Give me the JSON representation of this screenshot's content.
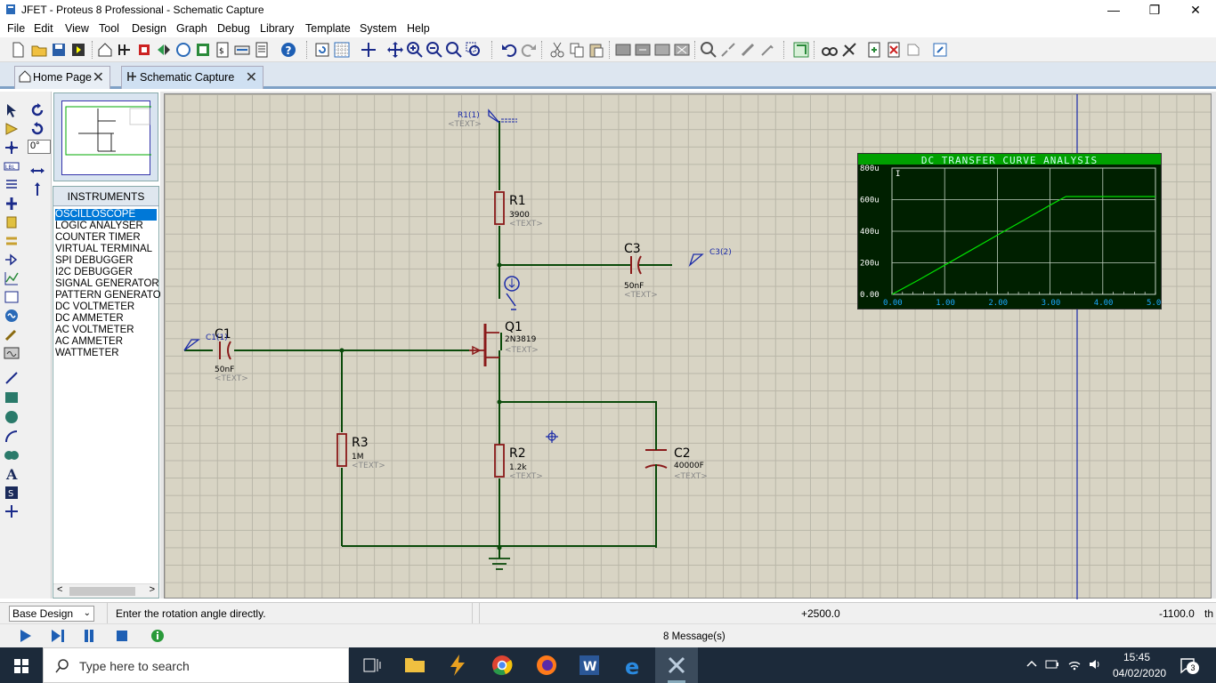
{
  "window": {
    "title": "JFET - Proteus 8 Professional - Schematic Capture",
    "minimize": "—",
    "restore": "❐",
    "close": "✕"
  },
  "menu": [
    "File",
    "Edit",
    "View",
    "Tool",
    "Design",
    "Graph",
    "Debug",
    "Library",
    "Template",
    "System",
    "Help"
  ],
  "tabs": [
    {
      "label": "Home Page",
      "close": "✕"
    },
    {
      "label": "Schematic Capture",
      "close": "✕"
    }
  ],
  "rotation": {
    "value": "0°"
  },
  "instruments": {
    "header": "INSTRUMENTS",
    "items": [
      "OSCILLOSCOPE",
      "LOGIC ANALYSER",
      "COUNTER TIMER",
      "VIRTUAL TERMINAL",
      "SPI DEBUGGER",
      "I2C DEBUGGER",
      "SIGNAL GENERATOR",
      "PATTERN GENERATO",
      "DC VOLTMETER",
      "DC AMMETER",
      "AC VOLTMETER",
      "AC AMMETER",
      "WATTMETER"
    ],
    "selected": 0
  },
  "schematic": {
    "components": {
      "R1": {
        "ref": "R1",
        "value": "3900",
        "text": "<TEXT>"
      },
      "R2": {
        "ref": "R2",
        "value": "1.2k",
        "text": "<TEXT>"
      },
      "R3": {
        "ref": "R3",
        "value": "1M",
        "text": "<TEXT>"
      },
      "C1": {
        "ref": "C1",
        "value": "50nF",
        "text": "<TEXT>"
      },
      "C2": {
        "ref": "C2",
        "value": "40000F",
        "text": "<TEXT>"
      },
      "C3": {
        "ref": "C3",
        "value": "50nF",
        "text": "<TEXT>"
      },
      "Q1": {
        "ref": "Q1",
        "value": "2N3819",
        "text": "<TEXT>"
      }
    },
    "probes": {
      "r1": {
        "label": "R1(1)",
        "text": "<TEXT>"
      },
      "c1": {
        "label": "C1(1)"
      },
      "c3": {
        "label": "C3(2)"
      }
    }
  },
  "graph": {
    "title": "DC TRANSFER CURVE ANALYSIS",
    "colors": {
      "background": "#002000",
      "titlebar": "#00a000",
      "trace": "#00e000",
      "grid": "#bfcfbf",
      "text": "#ffffff"
    }
  },
  "chart_data": {
    "type": "line",
    "title": "DC TRANSFER CURVE ANALYSIS",
    "xlabel": "",
    "ylabel": "I",
    "xlim": [
      0,
      5
    ],
    "ylim": [
      0,
      0.0008
    ],
    "x_ticks": [
      "0.00",
      "1.00",
      "2.00",
      "3.00",
      "4.00",
      "5.00"
    ],
    "y_ticks": [
      "0.00",
      "200u",
      "400u",
      "600u",
      "800u"
    ],
    "series": [
      {
        "x": [
          0,
          0.5,
          1,
          1.5,
          2,
          2.5,
          3,
          3.3,
          3.5,
          4,
          4.5,
          5
        ],
        "y": [
          0,
          9e-05,
          0.000185,
          0.00028,
          0.000375,
          0.00047,
          0.000565,
          0.00062,
          0.00062,
          0.00062,
          0.00062,
          0.00062
        ]
      }
    ]
  },
  "status": {
    "design": "Base Design",
    "message": "Enter the rotation angle directly.",
    "x": "+2500.0",
    "y": "-1100.0",
    "unit": "th"
  },
  "simulation": {
    "messages": "8 Message(s)"
  },
  "taskbar": {
    "search": "Type here to search",
    "time": "15:45",
    "date": "04/02/2020",
    "notifications": "3"
  }
}
